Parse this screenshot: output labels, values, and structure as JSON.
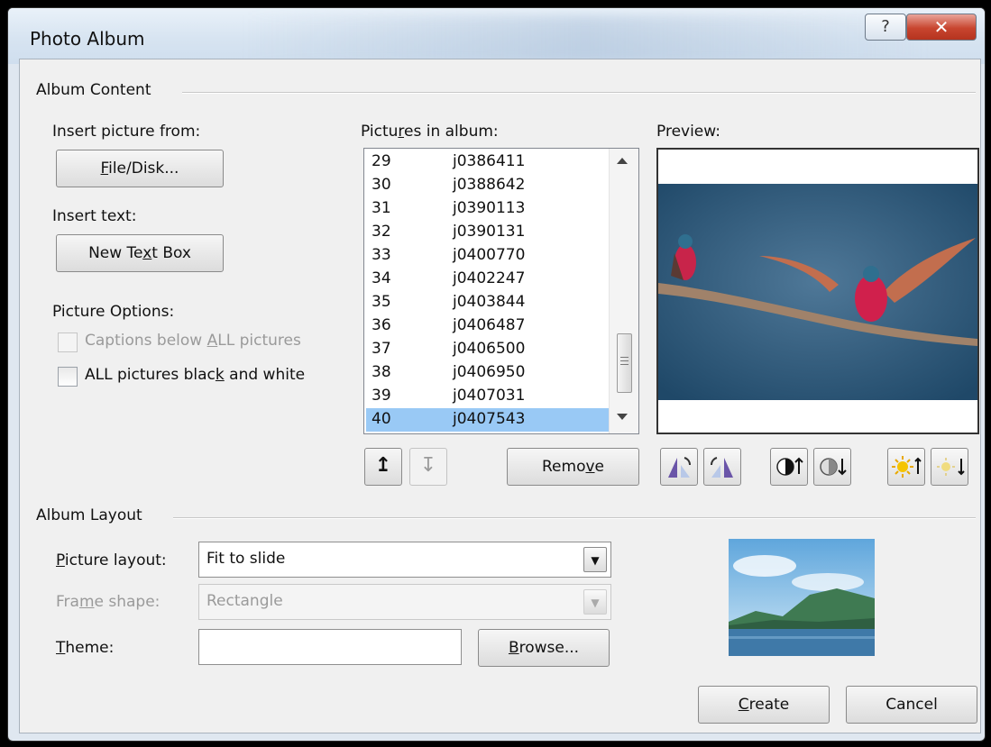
{
  "window": {
    "title": "Photo Album",
    "help_glyph": "?",
    "close_glyph": "✕"
  },
  "album_content": {
    "heading": "Album Content",
    "insert_picture_from_label": "Insert picture from:",
    "file_disk_button": {
      "pre": "",
      "key": "F",
      "post": "ile/Disk..."
    },
    "insert_text_label": "Insert text:",
    "new_text_box_button": {
      "pre": "New Te",
      "key": "x",
      "post": "t Box"
    },
    "picture_options_label": "Picture Options:",
    "captions_checkbox": {
      "pre": "Captions below ",
      "key": "A",
      "post": "LL pictures",
      "checked": false,
      "enabled": false
    },
    "bw_checkbox": {
      "pre": "ALL pictures blac",
      "key": "k",
      "post": " and white",
      "checked": false,
      "enabled": true
    },
    "pictures_in_album_label": {
      "pre": "Pictu",
      "key": "r",
      "post": "es in album:"
    },
    "pictures": [
      {
        "num": "29",
        "name": "j0386411"
      },
      {
        "num": "30",
        "name": "j0388642"
      },
      {
        "num": "31",
        "name": "j0390113"
      },
      {
        "num": "32",
        "name": "j0390131"
      },
      {
        "num": "33",
        "name": "j0400770"
      },
      {
        "num": "34",
        "name": "j0402247"
      },
      {
        "num": "35",
        "name": "j0403844"
      },
      {
        "num": "36",
        "name": "j0406487"
      },
      {
        "num": "37",
        "name": "j0406500"
      },
      {
        "num": "38",
        "name": "j0406950"
      },
      {
        "num": "39",
        "name": "j0407031"
      },
      {
        "num": "40",
        "name": "j0407543"
      }
    ],
    "selected_picture": "40",
    "move_up_glyph": "↥",
    "move_down_glyph": "↧",
    "remove_button": {
      "pre": "Remo",
      "key": "v",
      "post": "e"
    },
    "preview_label": "Preview:"
  },
  "album_layout": {
    "heading": "Album Layout",
    "picture_layout": {
      "label_key": "P",
      "label_post": "icture layout:",
      "value": "Fit to slide",
      "enabled": true
    },
    "frame_shape": {
      "label_pre": "Fra",
      "label_key": "m",
      "label_post": "e shape:",
      "value": "Rectangle",
      "enabled": false
    },
    "theme": {
      "label_key": "T",
      "label_post": "heme:",
      "value": ""
    },
    "browse_button": {
      "pre": "",
      "key": "B",
      "post": "rowse..."
    }
  },
  "footer": {
    "create_button": {
      "pre": "",
      "key": "C",
      "post": "reate"
    },
    "cancel_button": "Cancel"
  },
  "icons": {
    "scroll_up": "scroll-up-arrow-icon",
    "scroll_down": "scroll-down-arrow-icon",
    "rotate_left": "rotate-left-icon",
    "rotate_right": "rotate-right-icon",
    "contrast_up": "contrast-increase-icon",
    "contrast_down": "contrast-decrease-icon",
    "brightness_up": "brightness-increase-icon",
    "brightness_down": "brightness-decrease-icon"
  },
  "colors": {
    "selection": "#99c9f5",
    "close_button": "#c8452f",
    "titlebar": "#dde7f2"
  }
}
